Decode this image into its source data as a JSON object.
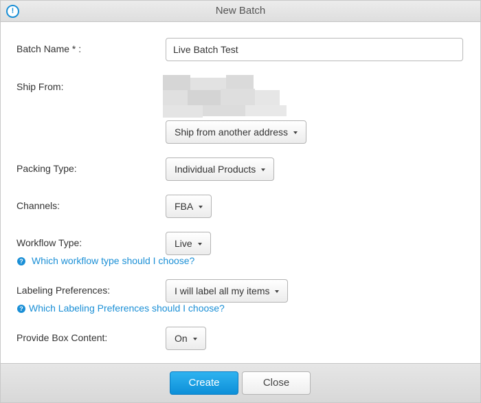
{
  "dialog": {
    "title": "New Batch"
  },
  "form": {
    "batch_name": {
      "label": "Batch Name * :",
      "value": "Live Batch Test"
    },
    "ship_from": {
      "label": "Ship From:",
      "button_label": "Ship from another address"
    },
    "packing_type": {
      "label": "Packing Type:",
      "selected": "Individual Products"
    },
    "channels": {
      "label": "Channels:",
      "selected": "FBA"
    },
    "workflow_type": {
      "label": "Workflow Type:",
      "selected": "Live",
      "help_text": "Which workflow type should I choose?"
    },
    "labeling_preferences": {
      "label": "Labeling Preferences:",
      "selected": "I will label all my items",
      "help_text": "Which Labeling Preferences should I choose?"
    },
    "box_content": {
      "label": "Provide Box Content:",
      "selected": "On"
    }
  },
  "footer": {
    "create_label": "Create",
    "close_label": "Close"
  },
  "icons": {
    "title_icon": "info-icon",
    "help_icon": "question-circle-icon",
    "caret": "caret-down-icon"
  },
  "colors": {
    "accent": "#1a8fd6",
    "primary_button": "#1a9fe3"
  }
}
